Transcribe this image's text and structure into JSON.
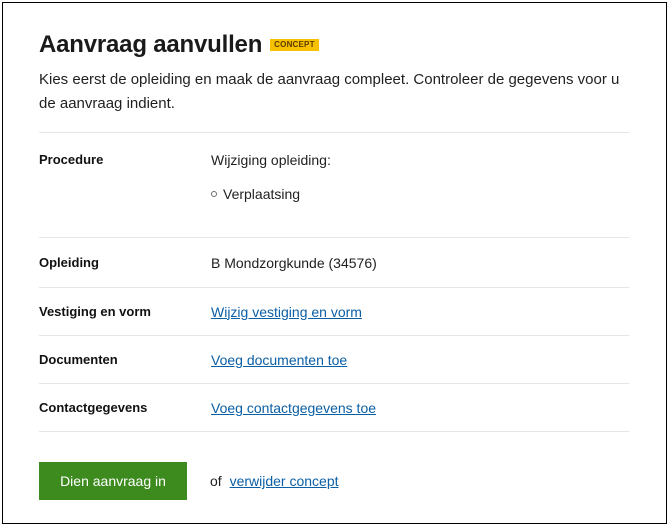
{
  "header": {
    "title": "Aanvraag aanvullen",
    "badge": "CONCEPT",
    "intro": "Kies eerst de opleiding en maak de aanvraag compleet. Controleer de gegevens voor u de aanvraag indient."
  },
  "rows": {
    "procedure": {
      "label": "Procedure",
      "value": "Wijziging opleiding:",
      "items": [
        "Verplaatsing"
      ]
    },
    "opleiding": {
      "label": "Opleiding",
      "value": "B Mondzorgkunde (34576)"
    },
    "vestiging": {
      "label": "Vestiging en vorm",
      "link": "Wijzig vestiging en vorm"
    },
    "documenten": {
      "label": "Documenten",
      "link": "Voeg documenten toe"
    },
    "contact": {
      "label": "Contactgegevens",
      "link": "Voeg contactgegevens toe"
    }
  },
  "actions": {
    "submit_label": "Dien aanvraag in",
    "or_text": "of",
    "delete_link": "verwijder concept"
  },
  "colors": {
    "badge": "#f6c200",
    "submit": "#3d8b1e",
    "link": "#0a5fa6"
  }
}
